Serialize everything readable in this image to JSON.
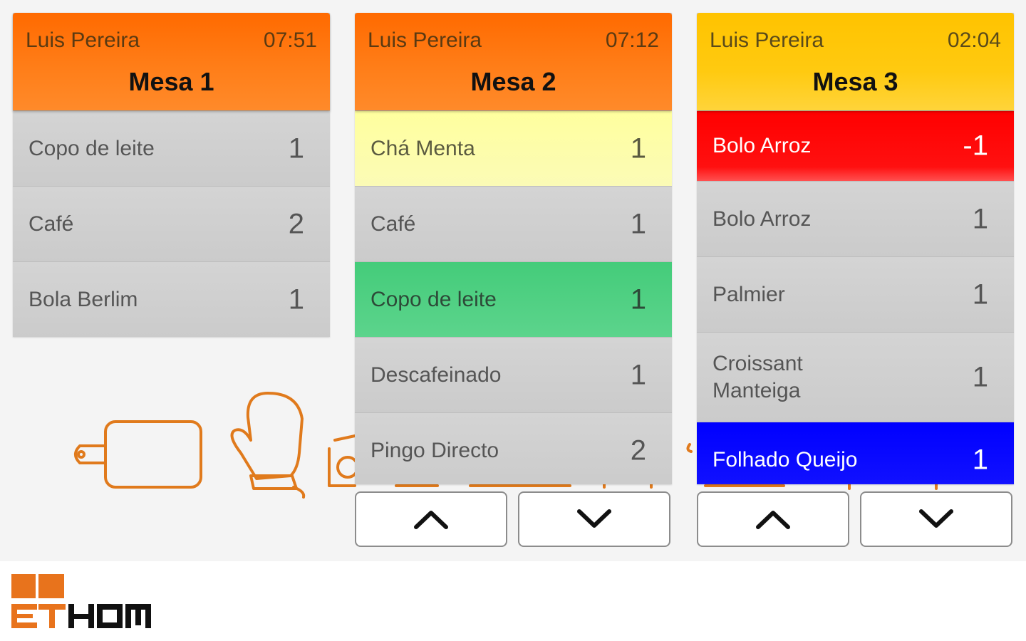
{
  "brand": {
    "logo_text": "ETHOM",
    "accent": "#ff6a00"
  },
  "orders": [
    {
      "waiter": "Luis Pereira",
      "time": "07:51",
      "table": "Mesa 1",
      "header_color": "#ff7a10",
      "items": [
        {
          "name": "Copo de leite",
          "qty": "1",
          "status": "normal"
        },
        {
          "name": "Café",
          "qty": "2",
          "status": "normal"
        },
        {
          "name": "Bola Berlim",
          "qty": "1",
          "status": "normal"
        }
      ]
    },
    {
      "waiter": "Luis Pereira",
      "time": "07:12",
      "table": "Mesa 2",
      "header_color": "#ff7a10",
      "items": [
        {
          "name": "Chá Menta",
          "qty": "1",
          "status": "yellow"
        },
        {
          "name": "Café",
          "qty": "1",
          "status": "normal"
        },
        {
          "name": "Copo de leite",
          "qty": "1",
          "status": "green"
        },
        {
          "name": "Descafeinado",
          "qty": "1",
          "status": "normal"
        },
        {
          "name": "Pingo Directo",
          "qty": "2",
          "status": "normal"
        }
      ],
      "scroll_up_icon": "chevron-up-icon",
      "scroll_down_icon": "chevron-down-icon"
    },
    {
      "waiter": "Luis Pereira",
      "time": "02:04",
      "table": "Mesa 3",
      "header_color": "#ffc800",
      "items": [
        {
          "name": "Bolo Arroz",
          "qty": "-1",
          "status": "red"
        },
        {
          "name": "Bolo Arroz",
          "qty": "1",
          "status": "normal"
        },
        {
          "name": "Palmier",
          "qty": "1",
          "status": "normal"
        },
        {
          "name": "Croissant Manteiga",
          "qty": "1",
          "status": "normal"
        },
        {
          "name": "Folhado Queijo",
          "qty": "1",
          "status": "blue"
        }
      ],
      "scroll_up_icon": "chevron-up-icon",
      "scroll_down_icon": "chevron-down-icon"
    }
  ]
}
